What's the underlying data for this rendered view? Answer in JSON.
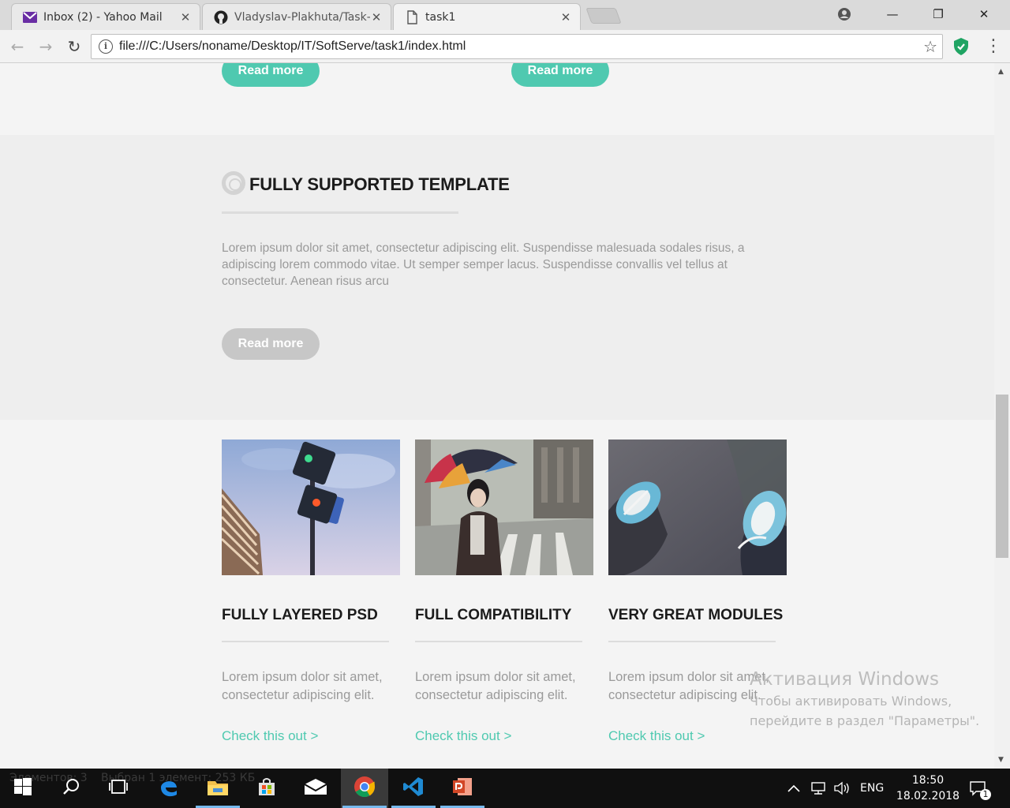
{
  "browser": {
    "tabs": [
      {
        "label": "Inbox (2) - Yahoo Mail",
        "icon": "yahoo-mail-icon"
      },
      {
        "label": "Vladyslav-Plakhuta/Task-",
        "icon": "github-icon"
      },
      {
        "label": "task1",
        "icon": "document-icon"
      }
    ],
    "url": "file:///C:/Users/noname/Desktop/IT/SoftServe/task1/index.html",
    "close_glyph": "✕",
    "back_glyph": "←",
    "forward_glyph": "→",
    "reload_glyph": "↻",
    "info_glyph": "i",
    "star_glyph": "☆",
    "menu_glyph": "⋮",
    "minimize_glyph": "—",
    "maximize_glyph": "❐",
    "window_close_glyph": "✕"
  },
  "page": {
    "top_buttons": [
      {
        "label": "Read more"
      },
      {
        "label": "Read more"
      }
    ],
    "support": {
      "title": "FULLY SUPPORTED TEMPLATE",
      "text_lines": [
        "Lorem ipsum dolor sit amet, consectetur adipiscing elit. Suspendisse malesuada sodales risus, a",
        "adipiscing lorem commodo vitae. Ut semper semper lacus. Suspendisse convallis vel tellus at",
        "consectetur. Aenean risus arcu"
      ],
      "button_label": "Read more"
    },
    "features": [
      {
        "title": "FULLY LAYERED PSD",
        "text_lines": [
          "Lorem ipsum dolor sit amet,",
          "consectetur adipiscing elit."
        ],
        "link": "Check this out >",
        "image": "traffic-light-photo"
      },
      {
        "title": "FULL COMPATIBILITY",
        "text_lines": [
          "Lorem ipsum dolor sit amet,",
          "consectetur adipiscing elit."
        ],
        "link": "Check this out >",
        "image": "umbrella-girl-photo"
      },
      {
        "title": "VERY GREAT MODULES",
        "text_lines": [
          "Lorem ipsum dolor sit amet,",
          "consectetur adipiscing elit."
        ],
        "link": "Check this out >",
        "image": "sneakers-photo"
      }
    ]
  },
  "watermark": {
    "line1": "Активация Windows",
    "line2": "Чтобы активировать Windows,",
    "line3": "перейдите в раздел \"Параметры\"."
  },
  "taskbar": {
    "devtools_left": "Элементов: 3",
    "devtools_right": "Выбран 1 элемент: 253 КБ",
    "language": "ENG",
    "time": "18:50",
    "date": "18.02.2018",
    "notification_count": "1"
  },
  "colors": {
    "accent": "#4fc9b0",
    "muted_button": "#c7c7c7",
    "band": "#eeeeee"
  }
}
